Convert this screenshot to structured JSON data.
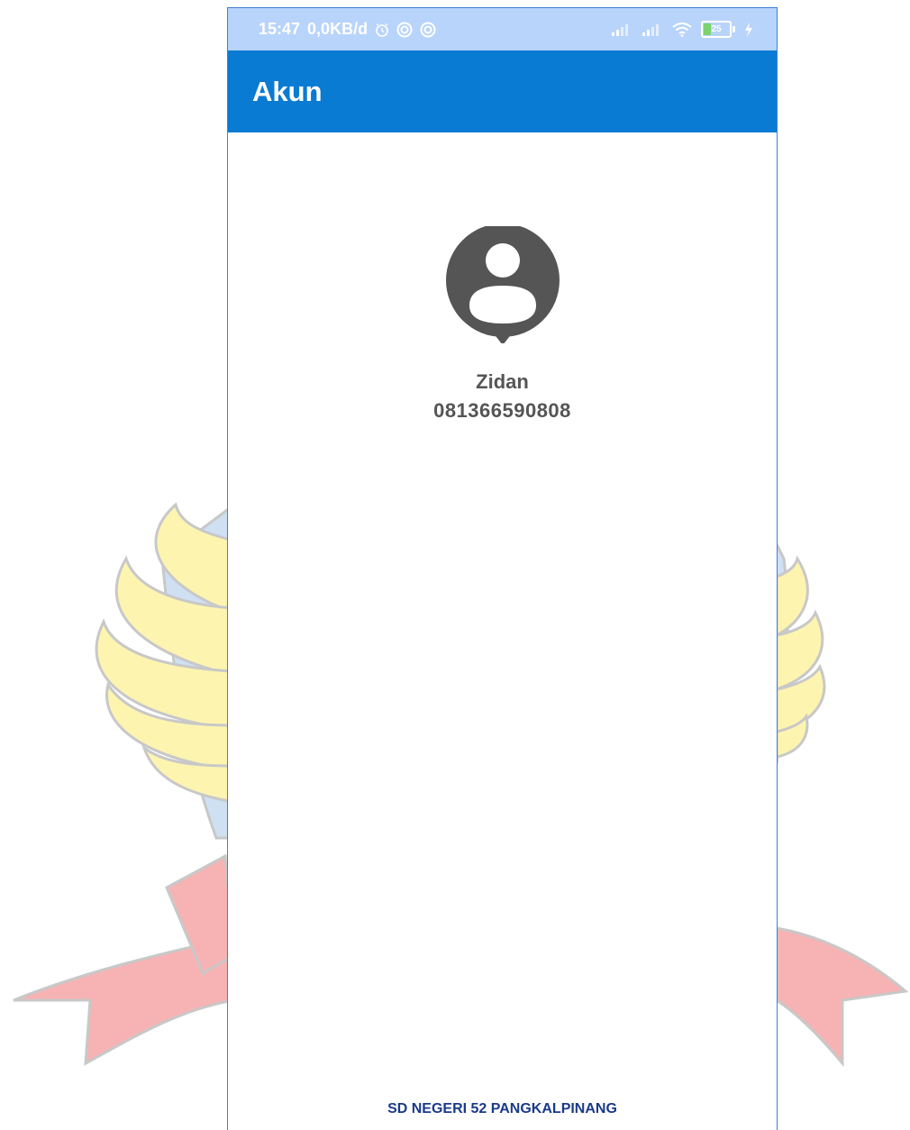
{
  "status_bar": {
    "time": "15:47",
    "net_speed": "0,0KB/d",
    "battery_level": "25",
    "battery_fraction": 0.25,
    "icons": [
      "alarm-icon",
      "sync-icon",
      "sync-icon",
      "signal-icon",
      "signal-icon",
      "wifi-icon",
      "battery-icon",
      "charging-icon"
    ]
  },
  "app_bar": {
    "title": "Akun",
    "color": "#0a7bd3"
  },
  "profile": {
    "name": "Zidan",
    "phone": "081366590808",
    "avatar_icon": "account-circle-icon"
  },
  "footer": {
    "text": "SD NEGERI 52 PANGKALPINANG"
  },
  "colors": {
    "status_bar": "#b8d4fb",
    "text_gray": "#555555",
    "footer_text": "#1a3a8a",
    "emblem_yellow": "#fdf4b0",
    "emblem_red": "#f7b3b3",
    "emblem_blue": "#cfe0f3"
  }
}
